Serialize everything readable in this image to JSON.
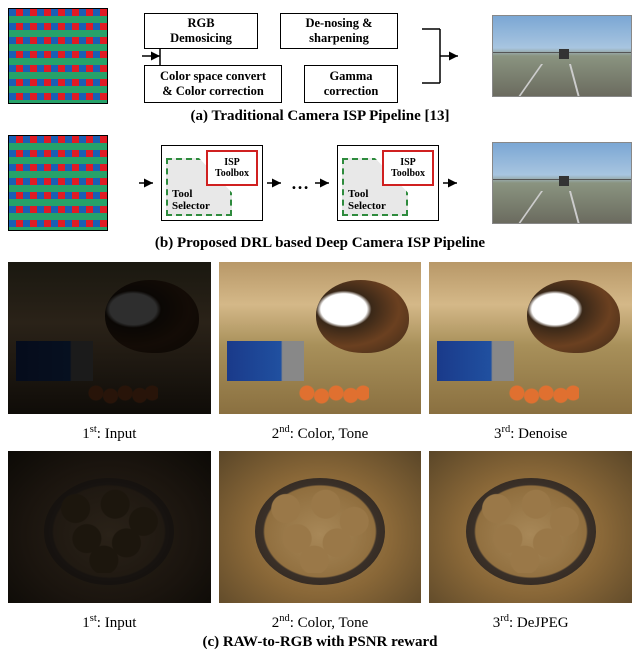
{
  "panel_a": {
    "boxes": {
      "demosaic": "RGB\nDemosicing",
      "sharpen": "De-nosing &\nsharpening",
      "color": "Color space convert\n& Color correction",
      "gamma": "Gamma\ncorrection"
    },
    "caption": "(a) Traditional Camera ISP Pipeline [13]"
  },
  "panel_b": {
    "module": {
      "selector": "Tool\nSelector",
      "toolbox": "ISP\nToolbox"
    },
    "ellipsis": "…",
    "caption": "(b) Proposed DRL based Deep Camera ISP Pipeline"
  },
  "panel_c": {
    "row1": {
      "c1": {
        "order": "1",
        "sup": "st",
        "label": ": Input"
      },
      "c2": {
        "order": "2",
        "sup": "nd",
        "label": ": Color, Tone"
      },
      "c3": {
        "order": "3",
        "sup": "rd",
        "label": ": Denoise"
      }
    },
    "row2": {
      "c1": {
        "order": "1",
        "sup": "st",
        "label": ": Input"
      },
      "c2": {
        "order": "2",
        "sup": "nd",
        "label": ": Color, Tone"
      },
      "c3": {
        "order": "3",
        "sup": "rd",
        "label": ": DeJPEG"
      }
    },
    "caption": "(c) RAW-to-RGB with PSNR reward"
  }
}
